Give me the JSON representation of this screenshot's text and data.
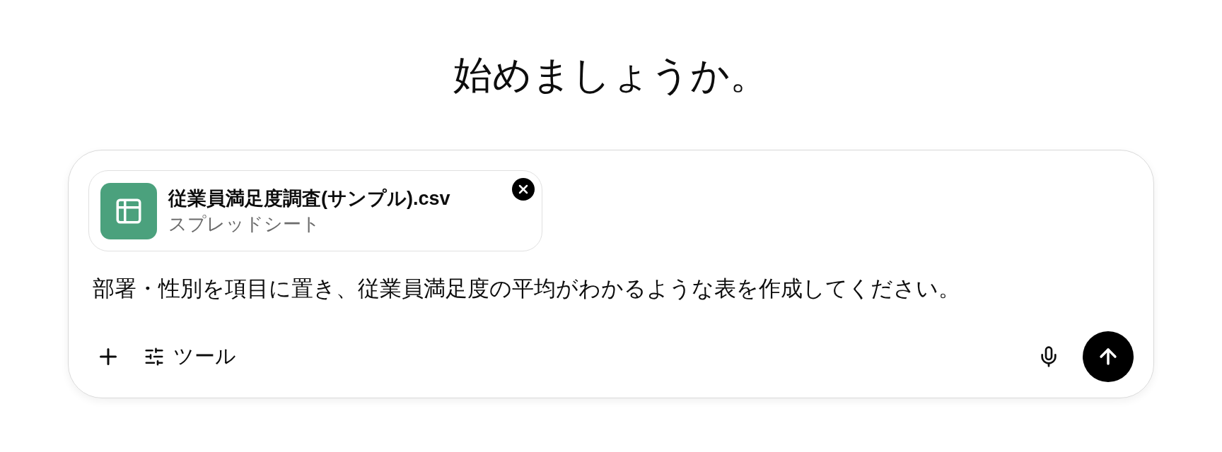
{
  "heading": "始めましょうか。",
  "composer": {
    "attachment": {
      "name": "従業員満足度調査(サンプル).csv",
      "type": "スプレッドシート"
    },
    "value": "部署・性別を項目に置き、従業員満足度の平均がわかるような表を作成してください。",
    "tools_label": "ツール"
  }
}
